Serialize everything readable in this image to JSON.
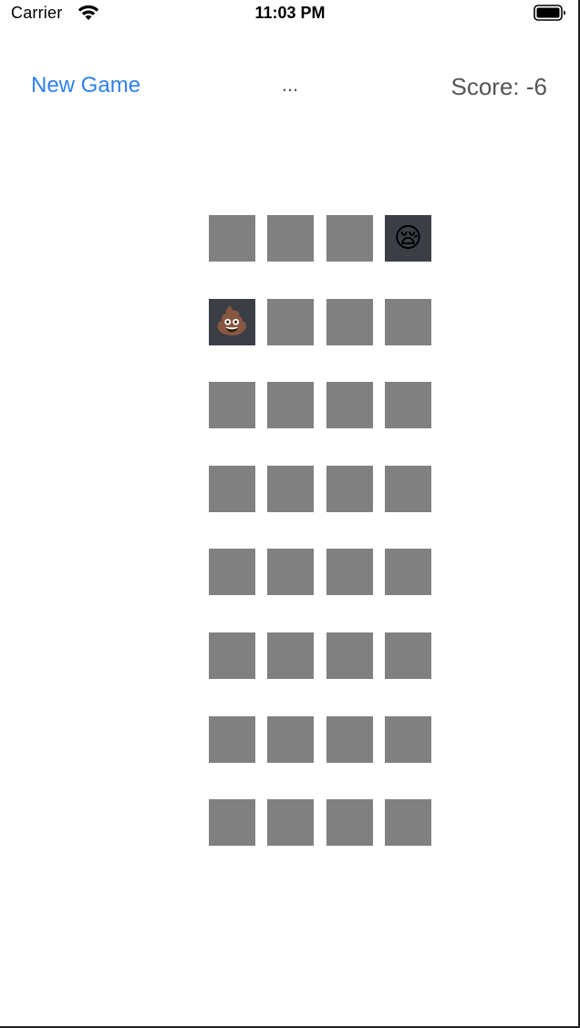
{
  "status_bar": {
    "carrier": "Carrier",
    "time": "11:03 PM"
  },
  "header": {
    "new_game_label": "New Game",
    "theme_name": "...",
    "score_text": "Score: -6"
  },
  "colors": {
    "accent": "#2f80ed",
    "card_back": "#808080",
    "card_face": "#3b3e45"
  },
  "cards": [
    {
      "face_up": false,
      "emoji": ""
    },
    {
      "face_up": false,
      "emoji": ""
    },
    {
      "face_up": false,
      "emoji": ""
    },
    {
      "face_up": true,
      "emoji": "😪"
    },
    {
      "face_up": true,
      "emoji": "💩"
    },
    {
      "face_up": false,
      "emoji": ""
    },
    {
      "face_up": false,
      "emoji": ""
    },
    {
      "face_up": false,
      "emoji": ""
    },
    {
      "face_up": false,
      "emoji": ""
    },
    {
      "face_up": false,
      "emoji": ""
    },
    {
      "face_up": false,
      "emoji": ""
    },
    {
      "face_up": false,
      "emoji": ""
    },
    {
      "face_up": false,
      "emoji": ""
    },
    {
      "face_up": false,
      "emoji": ""
    },
    {
      "face_up": false,
      "emoji": ""
    },
    {
      "face_up": false,
      "emoji": ""
    },
    {
      "face_up": false,
      "emoji": ""
    },
    {
      "face_up": false,
      "emoji": ""
    },
    {
      "face_up": false,
      "emoji": ""
    },
    {
      "face_up": false,
      "emoji": ""
    },
    {
      "face_up": false,
      "emoji": ""
    },
    {
      "face_up": false,
      "emoji": ""
    },
    {
      "face_up": false,
      "emoji": ""
    },
    {
      "face_up": false,
      "emoji": ""
    },
    {
      "face_up": false,
      "emoji": ""
    },
    {
      "face_up": false,
      "emoji": ""
    },
    {
      "face_up": false,
      "emoji": ""
    },
    {
      "face_up": false,
      "emoji": ""
    },
    {
      "face_up": false,
      "emoji": ""
    },
    {
      "face_up": false,
      "emoji": ""
    },
    {
      "face_up": false,
      "emoji": ""
    },
    {
      "face_up": false,
      "emoji": ""
    }
  ]
}
